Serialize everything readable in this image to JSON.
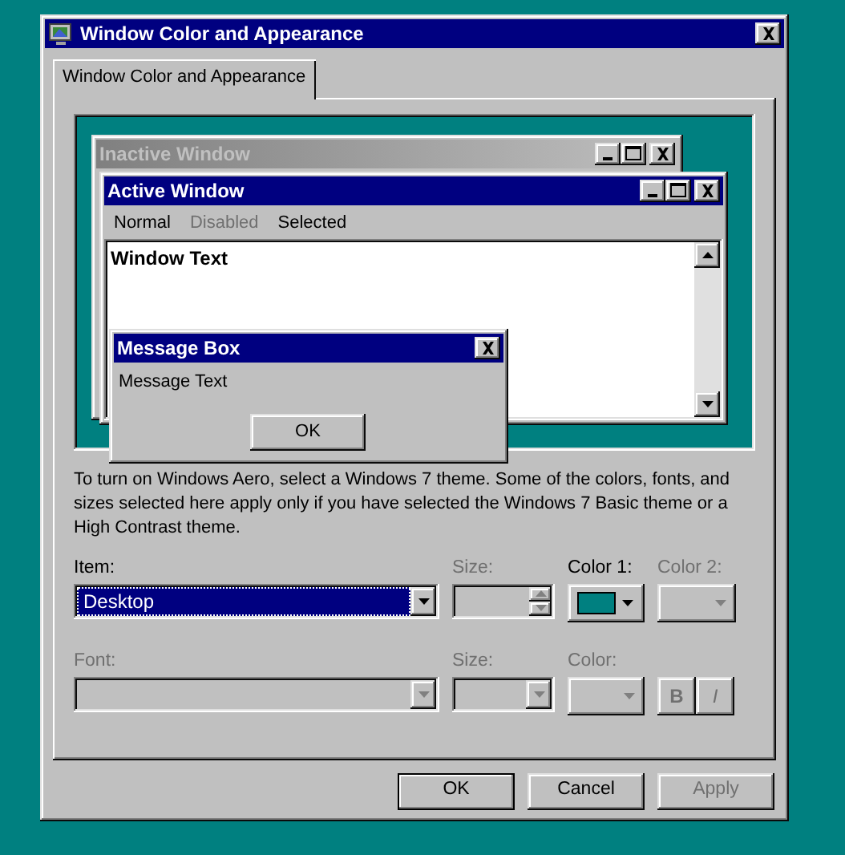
{
  "window": {
    "title": "Window Color and Appearance"
  },
  "tabs": [
    {
      "label": "Window Color and Appearance",
      "selected": true
    }
  ],
  "preview": {
    "inactive_window": {
      "title": "Inactive Window"
    },
    "active_window": {
      "title": "Active Window",
      "menu": [
        {
          "label": "Normal",
          "disabled": false
        },
        {
          "label": "Disabled",
          "disabled": true
        },
        {
          "label": "Selected",
          "disabled": false
        }
      ],
      "text": "Window Text"
    },
    "message_box": {
      "title": "Message Box",
      "text": "Message Text",
      "button": "OK"
    }
  },
  "description": "To turn on Windows Aero, select a Windows 7 theme.  Some of the colors, fonts, and sizes selected here apply only if you have selected the Windows 7 Basic theme or a High Contrast theme.",
  "item": {
    "label": "Item:",
    "value": "Desktop",
    "disabled": false
  },
  "item_size": {
    "label": "Size:",
    "disabled": true
  },
  "color_1": {
    "label": "Color 1:",
    "color": "#008080",
    "disabled": false
  },
  "color_2": {
    "label": "Color 2:",
    "disabled": true
  },
  "font": {
    "label": "Font:",
    "disabled": true
  },
  "font_size": {
    "label": "Size:",
    "disabled": true
  },
  "font_color": {
    "label": "Color:",
    "disabled": true
  },
  "style_buttons": [
    {
      "label": "B",
      "disabled": true
    },
    {
      "label": "I",
      "disabled": true
    }
  ],
  "buttons": [
    {
      "label": "OK",
      "default": true,
      "disabled": false
    },
    {
      "label": "Cancel",
      "default": false,
      "disabled": false
    },
    {
      "label": "Apply",
      "default": false,
      "disabled": true
    }
  ]
}
